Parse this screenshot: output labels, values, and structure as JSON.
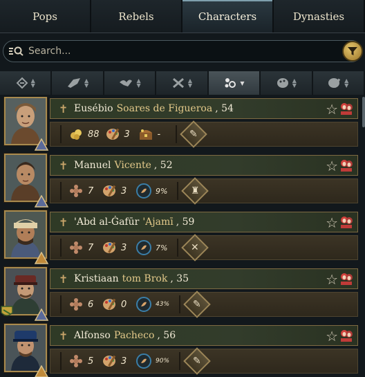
{
  "tabs": [
    {
      "label": "Pops",
      "active": false
    },
    {
      "label": "Rebels",
      "active": false
    },
    {
      "label": "Characters",
      "active": true
    },
    {
      "label": "Dynasties",
      "active": false
    }
  ],
  "search": {
    "placeholder": "Search..."
  },
  "sort_columns": [
    {
      "icon": "age-sort-icon"
    },
    {
      "icon": "martial-sort-icon"
    },
    {
      "icon": "diplomacy-sort-icon"
    },
    {
      "icon": "military-sort-icon"
    },
    {
      "icon": "finesse-sort-icon",
      "active": true
    },
    {
      "icon": "charisma-sort-icon"
    },
    {
      "icon": "zeal-sort-icon"
    }
  ],
  "characters": [
    {
      "first": "Eusébio",
      "last": "Soares de Figueroa",
      "age": ", 54",
      "stat1_icon": "gold-coins-icon",
      "stat1": "88",
      "stat2": "3",
      "stat3_icon": "treasure-chest-icon",
      "stat3": "-",
      "progress": null,
      "focus_icon": "scroll-quill-icon"
    },
    {
      "first": "Manuel",
      "last": "Vicente",
      "age": ", 52",
      "stat1_icon": "bloom-icon",
      "stat1": "7",
      "stat2": "3",
      "stat3_icon": null,
      "stat3": null,
      "progress": "9%",
      "focus_icon": "obelisk-icon"
    },
    {
      "first": "'Abd al-Ġafūr",
      "last": "'Ajamī",
      "age": ", 59",
      "stat1_icon": "bloom-icon",
      "stat1": "7",
      "stat2": "3",
      "stat3_icon": null,
      "stat3": null,
      "progress": "7%",
      "focus_icon": "crossed-tools-icon"
    },
    {
      "first": "Kristiaan",
      "last": "tom Brok",
      "age": ", 35",
      "stat1_icon": "bloom-icon",
      "stat1": "6",
      "stat2": "0",
      "stat3_icon": null,
      "stat3": null,
      "progress": "43%",
      "focus_icon": "scroll-quill-icon"
    },
    {
      "first": "Alfonso",
      "last": "Pacheco",
      "age": ", 56",
      "stat1_icon": "bloom-icon",
      "stat1": "5",
      "stat2": "3",
      "stat3_icon": null,
      "stat3": null,
      "progress": "90%",
      "focus_icon": "scroll-quill-icon"
    }
  ],
  "colors": {
    "accent_gold": "#a88a4e",
    "name_gold": "#e3c98a",
    "progress_ring": "#3a7ea8"
  }
}
